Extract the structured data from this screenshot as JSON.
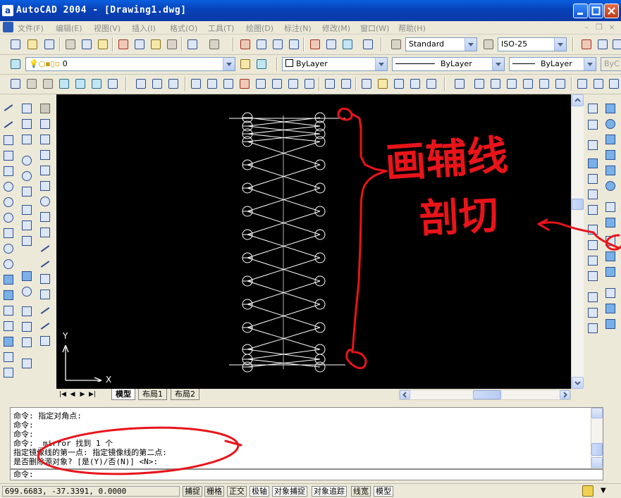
{
  "window": {
    "title": "AutoCAD 2004 - [Drawing1.dwg]",
    "app_icon": "a"
  },
  "menu": {
    "items": [
      "文件(F)",
      "编辑(E)",
      "视图(V)",
      "插入(I)",
      "格式(O)",
      "工具(T)",
      "绘图(D)",
      "标注(N)",
      "修改(M)",
      "窗口(W)",
      "帮助(H)"
    ]
  },
  "toolbar": {
    "text_style": "Standard",
    "dim_style": "ISO-25",
    "layer": "0",
    "color": "ByLayer",
    "linetype": "ByLayer",
    "lineweight": "ByLayer",
    "plot_style": "ByC"
  },
  "ucs": {
    "x_label": "X",
    "y_label": "Y"
  },
  "tabs": {
    "model": "模型",
    "layout1": "布局1",
    "layout2": "布局2"
  },
  "command": {
    "lines": [
      "命令: 指定对角点:",
      "命令:",
      "命令:",
      "命令: _mirror 找到 1 个",
      "指定镜像线的第一点: 指定镜像线的第二点:",
      "是否删除源对象? [是(Y)/否(N)] <N>:"
    ],
    "prompt": "命令:"
  },
  "status": {
    "coords": "699.6683, -37.3391, 0.0000",
    "toggles": [
      {
        "label": "捕捉",
        "on": false
      },
      {
        "label": "栅格",
        "on": false
      },
      {
        "label": "正交",
        "on": false
      },
      {
        "label": "极轴",
        "on": true
      },
      {
        "label": "对象捕捉",
        "on": true
      },
      {
        "label": "对象追踪",
        "on": true
      },
      {
        "label": "线宽",
        "on": false
      },
      {
        "label": "模型",
        "on": true
      }
    ]
  },
  "annotations": {
    "note_line1": "画辅线",
    "note_line2": "剖切",
    "color": "#e8141a"
  },
  "colors": {
    "canvas": "#000000",
    "title_bar": "#0842b8",
    "drawing": "#ffffff"
  }
}
